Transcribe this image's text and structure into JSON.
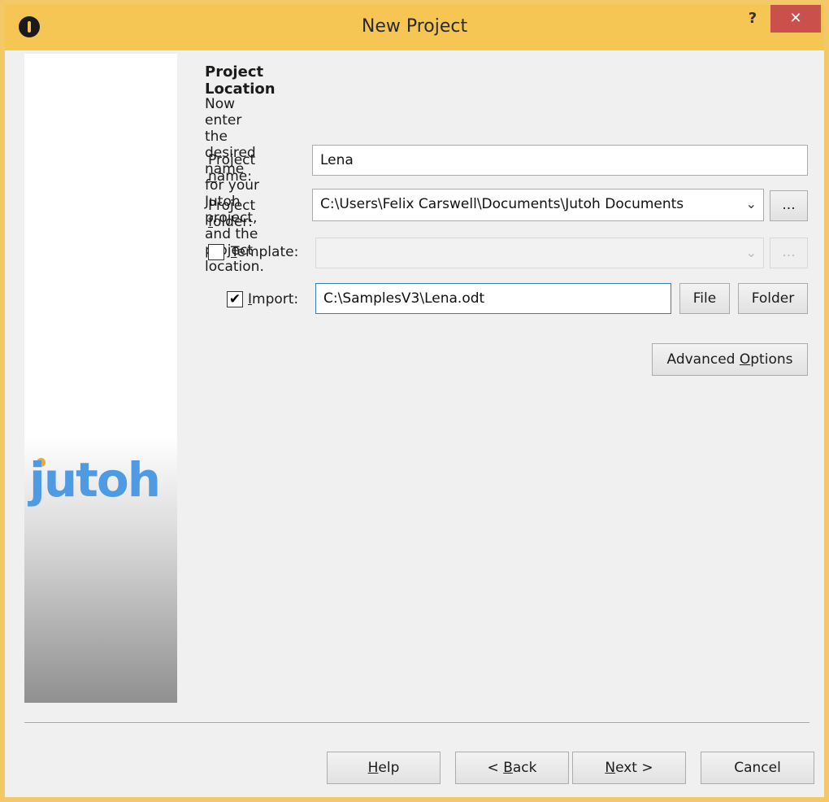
{
  "window": {
    "title": "New Project",
    "help_label": "?",
    "close_label": "✕",
    "app_icon": "jutoh-app-icon"
  },
  "sidebar": {
    "logo_text": "jutoh"
  },
  "page": {
    "heading": "Project Location",
    "description": "Now enter the desired name for your Jutoh project, and the project location."
  },
  "form": {
    "project_name": {
      "label_pre": "Project ",
      "label_ul": "n",
      "label_post": "ame:",
      "value": "Lena"
    },
    "project_folder": {
      "label_pre": "Project ",
      "label_ul": "f",
      "label_post": "older:",
      "value": "C:\\Users\\Felix Carswell\\Documents\\Jutoh Documents",
      "browse_label": "..."
    },
    "template": {
      "label_ul": "T",
      "label_post": "emplate:",
      "checked": false,
      "value": "",
      "browse_label": "..."
    },
    "import": {
      "label_ul": "I",
      "label_post": "mport:",
      "checked": true,
      "check_glyph": "✔",
      "value": "C:\\SamplesV3\\Lena.odt",
      "file_label": "File",
      "folder_label": "Folder"
    },
    "advanced": {
      "label_pre": "Advanced ",
      "label_ul": "O",
      "label_post": "ptions"
    }
  },
  "footer": {
    "help": {
      "ul": "H",
      "post": "elp"
    },
    "back": {
      "pre": "< ",
      "ul": "B",
      "post": "ack"
    },
    "next": {
      "ul": "N",
      "post": "ext >"
    },
    "cancel": "Cancel"
  },
  "colors": {
    "titlebar": "#f6c654",
    "close": "#c9504b",
    "logo": "#4e9ae3",
    "logo_dot": "#f5a530"
  }
}
